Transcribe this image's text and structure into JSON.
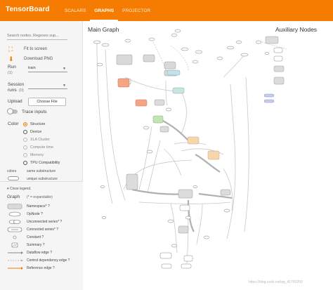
{
  "header": {
    "brand": "TensorBoard",
    "tabs": [
      {
        "label": "SCALARS",
        "active": false
      },
      {
        "label": "GRAPHS",
        "active": true
      },
      {
        "label": "PROJECTOR",
        "active": false
      }
    ],
    "color": "#f57c00"
  },
  "sidebar": {
    "search_placeholder": "Search nodes. Regexes sup...",
    "fit_label": "Fit to screen",
    "download_label": "Download PNG",
    "run_label": "Run",
    "run_count": "(1)",
    "run_value": "train",
    "session_label_1": "Session",
    "session_label_2": "runs",
    "session_count": "(0)",
    "upload_label": "Upload",
    "choose_file": "Choose File",
    "trace_inputs": "Trace inputs",
    "color_label": "Color",
    "color_options": [
      {
        "label": "Structure",
        "state": "selected"
      },
      {
        "label": "Device",
        "state": "enabled"
      },
      {
        "label": "XLA Cluster",
        "state": "disabled"
      },
      {
        "label": "Compute time",
        "state": "disabled"
      },
      {
        "label": "Memory",
        "state": "disabled"
      },
      {
        "label": "TPU Compatibility",
        "state": "enabled"
      }
    ],
    "colors_label": "colors",
    "same_substructure": "same substructure",
    "unique_substructure": "unique substructure"
  },
  "legend": {
    "close_label": "Close legend.",
    "title": "Graph",
    "subtitle": "(* = expandable)",
    "items": [
      "Namespace* ?",
      "OpNode ?",
      "Unconnected series* ?",
      "Connected series* ?",
      "Constant ?",
      "Summary ?",
      "Dataflow edge ?",
      "Control dependency edge ?",
      "Reference edge ?"
    ]
  },
  "graph": {
    "main_title": "Main Graph",
    "aux_title": "Auxiliary Nodes"
  },
  "watermark": "https://blog.csdn.net/qq_41760290"
}
